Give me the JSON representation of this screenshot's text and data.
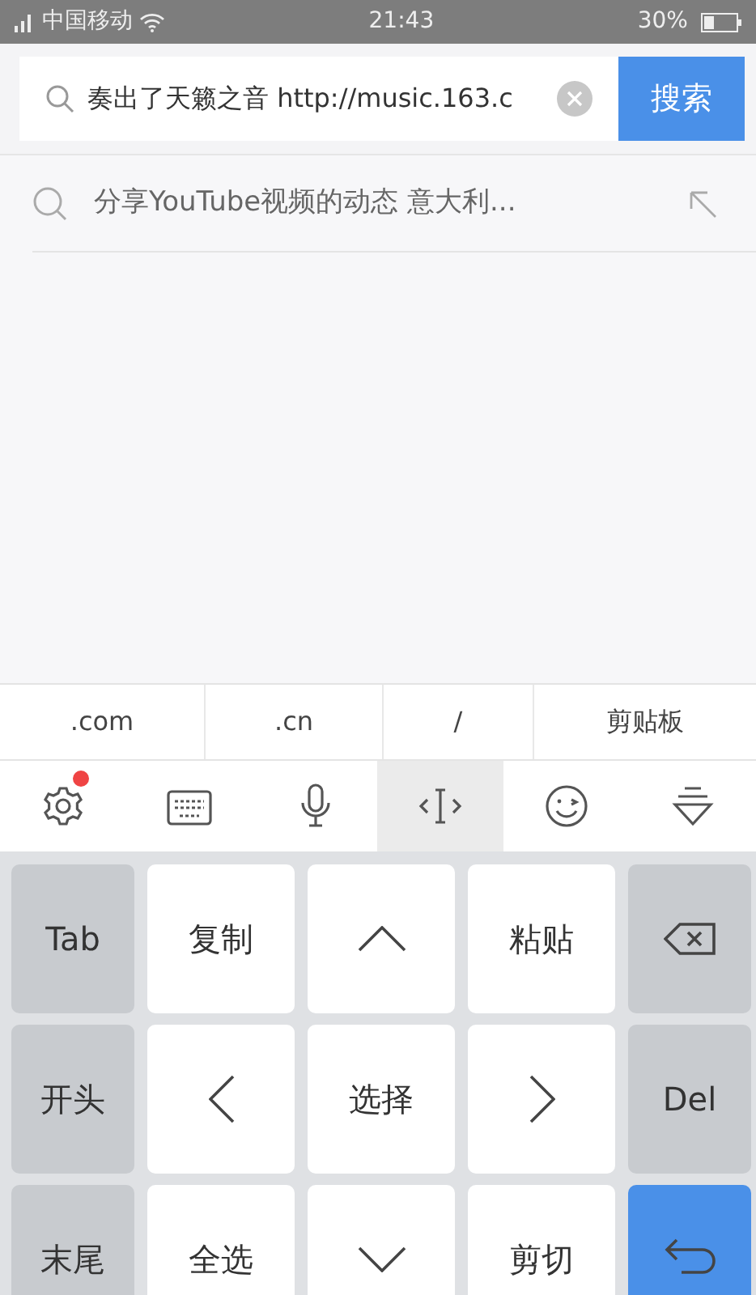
{
  "status_bar": {
    "carrier": "中国移动",
    "time": "21:43",
    "battery": "30%"
  },
  "search": {
    "value": "奏出了天籁之音 http://music.163.c",
    "button": "搜索"
  },
  "suggestions": [
    {
      "text": "分享YouTube视频的动态 意大利..."
    }
  ],
  "shortcuts": [
    ".com",
    ".cn",
    "/",
    "剪贴板"
  ],
  "toolbar": [
    {
      "kind": "settings",
      "selected": false,
      "badge": true
    },
    {
      "kind": "keyboard",
      "selected": false,
      "badge": false
    },
    {
      "kind": "mic",
      "selected": false,
      "badge": false
    },
    {
      "kind": "cursor",
      "selected": true,
      "badge": false
    },
    {
      "kind": "emoji",
      "selected": false,
      "badge": false
    },
    {
      "kind": "collapse",
      "selected": false,
      "badge": false
    }
  ],
  "keys": [
    {
      "kind": "func",
      "label": "Tab"
    },
    {
      "kind": "char",
      "label": "复制"
    },
    {
      "kind": "arrow-up"
    },
    {
      "kind": "char",
      "label": "粘贴"
    },
    {
      "kind": "backspace"
    },
    {
      "kind": "func",
      "label": "开头"
    },
    {
      "kind": "arrow-left"
    },
    {
      "kind": "char",
      "label": "选择"
    },
    {
      "kind": "arrow-right"
    },
    {
      "kind": "func",
      "label": "Del"
    },
    {
      "kind": "func",
      "label": "末尾"
    },
    {
      "kind": "char",
      "label": "全选"
    },
    {
      "kind": "arrow-down"
    },
    {
      "kind": "char",
      "label": "剪切"
    },
    {
      "kind": "enter"
    }
  ]
}
